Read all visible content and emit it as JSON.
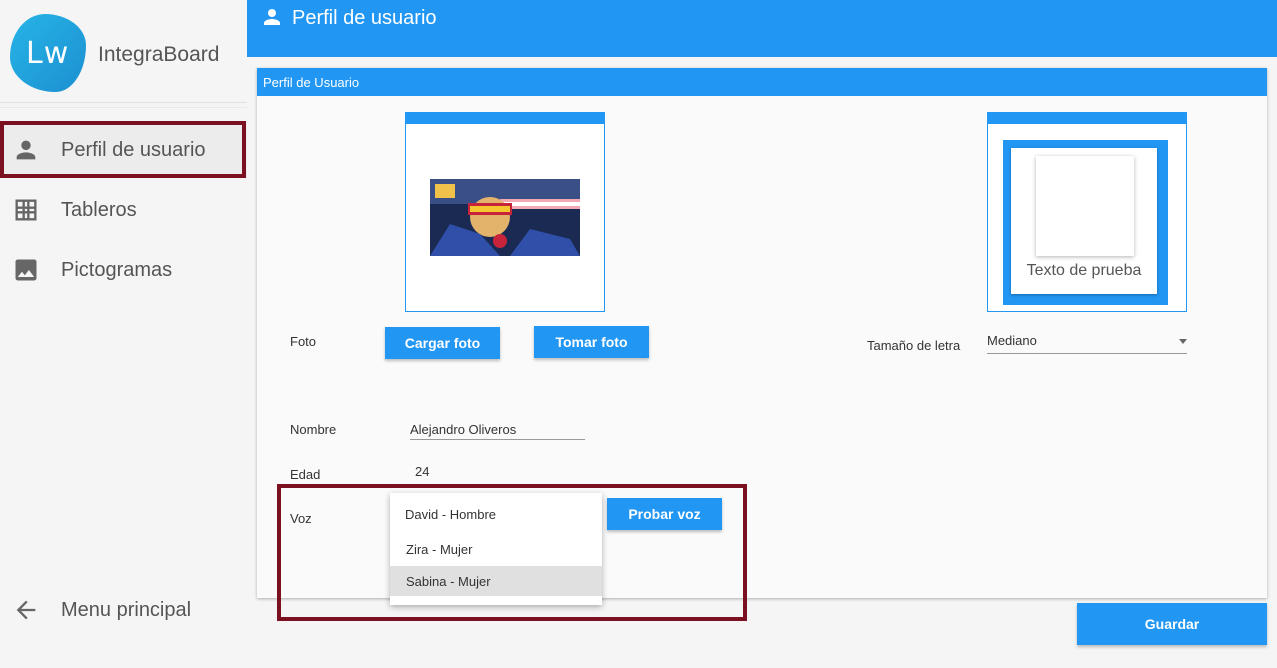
{
  "app": {
    "logo_text": "Lw",
    "name": "IntegraBoard"
  },
  "sidebar": {
    "items": [
      {
        "label": "Perfil de usuario",
        "icon": "person-icon"
      },
      {
        "label": "Tableros",
        "icon": "grid-icon"
      },
      {
        "label": "Pictogramas",
        "icon": "image-icon"
      }
    ],
    "back": {
      "label": "Menu principal",
      "icon": "arrow-back-icon"
    }
  },
  "header": {
    "title": "Perfil de usuario",
    "icon": "person-icon"
  },
  "card": {
    "title": "Perfil de Usuario",
    "photo_label": "Foto",
    "upload_button": "Cargar foto",
    "take_photo_button": "Tomar foto",
    "font_preview_text": "Texto de prueba",
    "font_size_label": "Tamaño de letra",
    "font_size_value": "Mediano",
    "name_label": "Nombre",
    "name_value": "Alejandro Oliveros",
    "age_label": "Edad",
    "age_value": "24",
    "voice_label": "Voz",
    "test_voice_button": "Probar voz",
    "voice_options": [
      "David - Hombre",
      "Zira - Mujer",
      "Sabina - Mujer"
    ],
    "voice_selected": "Sabina - Mujer"
  },
  "save_button": "Guardar",
  "colors": {
    "primary": "#2196f3",
    "highlight": "#7b1020"
  }
}
